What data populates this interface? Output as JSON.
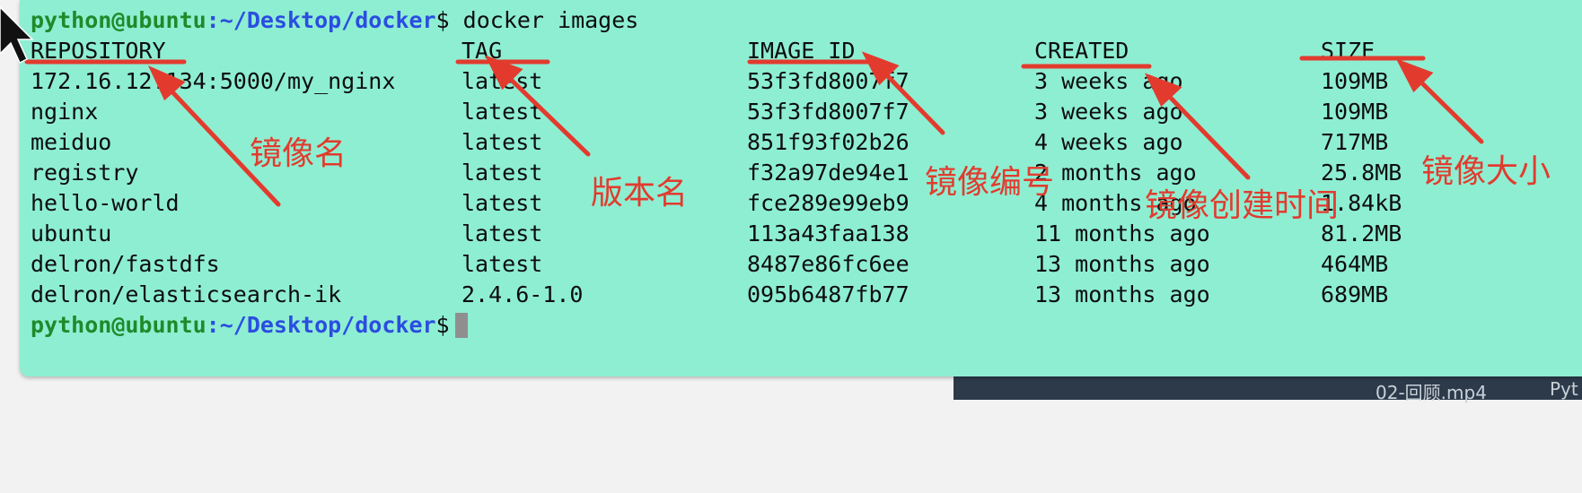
{
  "terminal": {
    "prompt": {
      "user_host": "python@ubuntu",
      "path": ":~/Desktop/docker",
      "symbol": "$"
    },
    "command": " docker images",
    "headers": [
      "REPOSITORY",
      "TAG",
      "IMAGE ID",
      "CREATED",
      "SIZE"
    ],
    "rows": [
      [
        "172.16.12.134:5000/my_nginx",
        "latest",
        "53f3fd8007f7",
        "3 weeks ago",
        "109MB"
      ],
      [
        "nginx",
        "latest",
        "53f3fd8007f7",
        "3 weeks ago",
        "109MB"
      ],
      [
        "meiduo",
        "latest",
        "851f93f02b26",
        "4 weeks ago",
        "717MB"
      ],
      [
        "registry",
        "latest",
        "f32a97de94e1",
        "2 months ago",
        "25.8MB"
      ],
      [
        "hello-world",
        "latest",
        "fce289e99eb9",
        "4 months ago",
        "1.84kB"
      ],
      [
        "ubuntu",
        "latest",
        "113a43faa138",
        "11 months ago",
        "81.2MB"
      ],
      [
        "delron/fastdfs",
        "latest",
        "8487e86fc6ee",
        "13 months ago",
        "464MB"
      ],
      [
        "delron/elasticsearch-ik",
        "2.4.6-1.0",
        "095b6487fb77",
        "13 months ago",
        "689MB"
      ]
    ]
  },
  "annotations": {
    "repository": "镜像名",
    "tag": "版本名",
    "image_id": "镜像编号",
    "created": "镜像创建时间",
    "size": "镜像大小"
  },
  "background": {
    "video_title": "02-回顾.mp4",
    "video_title_2": "Pyt"
  },
  "colors": {
    "terminal_bg": "#8eeed2",
    "prompt_user": "#1e8a2a",
    "prompt_path": "#2b4de0",
    "annotation": "#e23b2e"
  }
}
